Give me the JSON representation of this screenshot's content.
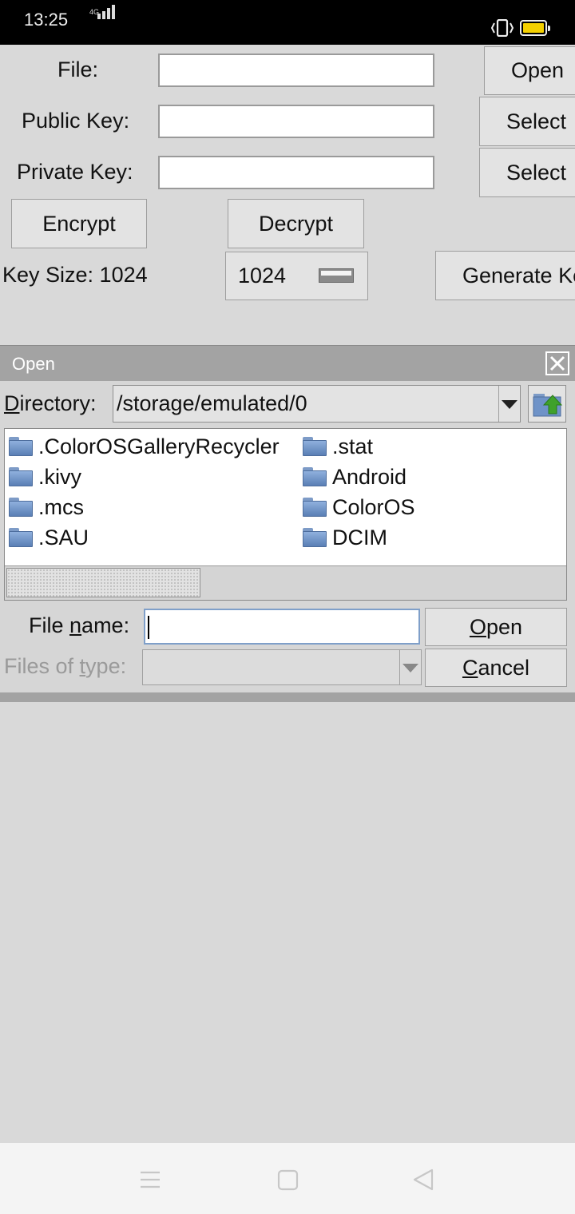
{
  "status_bar": {
    "time": "13:25",
    "network": "4G"
  },
  "main": {
    "file_label": "File:",
    "file_value": "",
    "open_button": "Open",
    "public_key_label": "Public Key:",
    "public_key_value": "",
    "public_select_button": "Select",
    "private_key_label": "Private Key:",
    "private_key_value": "",
    "private_select_button": "Select",
    "encrypt_button": "Encrypt",
    "decrypt_button": "Decrypt",
    "key_size_label": "Key Size: 1024",
    "key_size_spinner": "1024",
    "generate_button": "Generate Keys"
  },
  "dialog": {
    "title": "Open",
    "directory_label_first": "D",
    "directory_label_rest": "irectory:",
    "directory_value": "/storage/emulated/0",
    "files": [
      {
        "name": ".ColorOSGalleryRecycler"
      },
      {
        "name": ".kivy"
      },
      {
        "name": ".mcs"
      },
      {
        "name": ".SAU"
      },
      {
        "name": ".stat"
      },
      {
        "name": "Android"
      },
      {
        "name": "ColorOS"
      },
      {
        "name": "DCIM"
      }
    ],
    "file_name_label_a": "File ",
    "file_name_label_u": "n",
    "file_name_label_b": "ame:",
    "file_name_value": "",
    "open_button_u": "O",
    "open_button_rest": "pen",
    "files_of_type_label_a": "Files of ",
    "files_of_type_label_u": "t",
    "files_of_type_label_b": "ype:",
    "files_of_type_value": "",
    "cancel_button_u": "C",
    "cancel_button_rest": "ancel"
  },
  "colors": {
    "battery": "#f4d000",
    "dialog_title_bar": "#a3a3a3",
    "up_arrow": "#3fa12b"
  }
}
